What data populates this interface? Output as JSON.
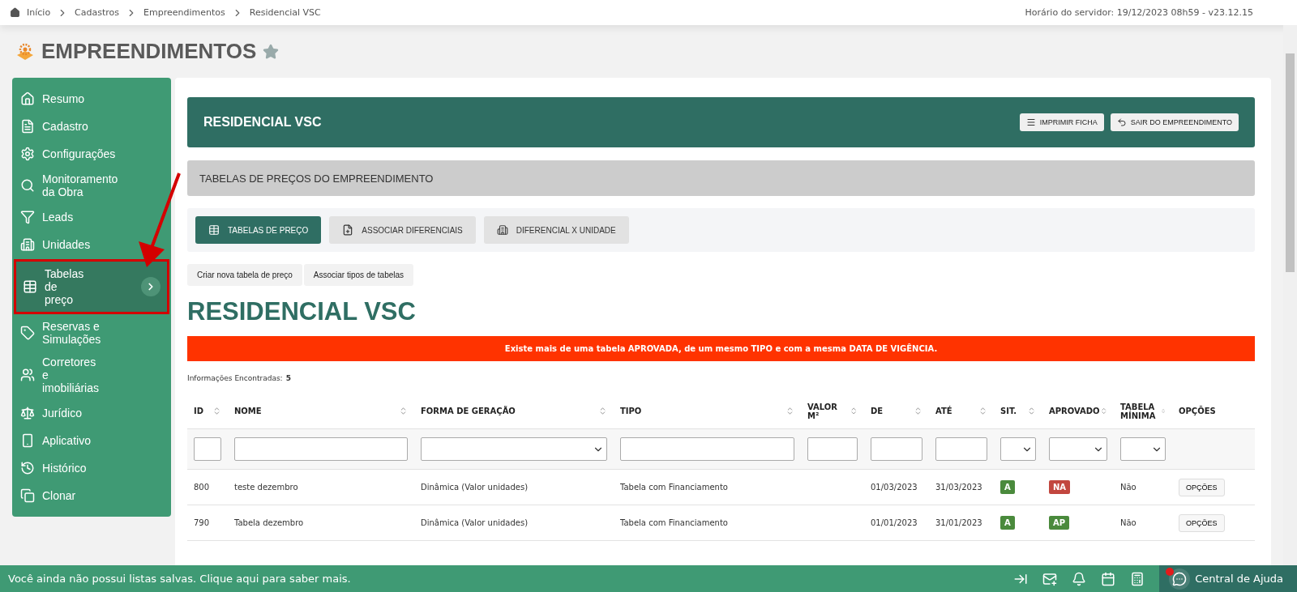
{
  "breadcrumbs": [
    "Início",
    "Cadastros",
    "Empreendimentos",
    "Residencial VSC"
  ],
  "server_info": "Horário do servidor: 19/12/2023 08h59 - v23.12.15",
  "page_title": "EMPREENDIMENTOS",
  "favorite": false,
  "sidebar": {
    "items": [
      {
        "label": "Resumo",
        "selected": false
      },
      {
        "label": "Cadastro",
        "selected": false
      },
      {
        "label": "Configurações",
        "selected": false
      },
      {
        "label": "Monitoramento da Obra",
        "selected": false
      },
      {
        "label": "Leads",
        "selected": false
      },
      {
        "label": "Unidades",
        "selected": false
      },
      {
        "label": "Tabelas de preço",
        "selected": true,
        "annotated": true
      },
      {
        "label": "Reservas e Simulações",
        "selected": false
      },
      {
        "label": "Corretores e imobiliárias",
        "selected": false
      },
      {
        "label": "Jurídico",
        "selected": false
      },
      {
        "label": "Aplicativo",
        "selected": false
      },
      {
        "label": "Histórico",
        "selected": false
      },
      {
        "label": "Clonar",
        "selected": false
      }
    ]
  },
  "header": {
    "title": "RESIDENCIAL VSC",
    "buttons": [
      "IMPRIMIR FICHA",
      "SAIR DO EMPREENDIMENTO"
    ]
  },
  "section_title": "TABELAS DE PREÇOS DO EMPREENDIMENTO",
  "tabs": [
    {
      "label": "TABELAS DE PREÇO",
      "selected": true
    },
    {
      "label": "ASSOCIAR DIFERENCIAIS",
      "selected": false
    },
    {
      "label": "DIFERENCIAL X UNIDADE",
      "selected": false
    }
  ],
  "actions": [
    "Criar nova tabela de preço",
    "Associar tipos de tabelas"
  ],
  "heading": "RESIDENCIAL VSC",
  "alert": "Existe mais de uma tabela APROVADA, de um mesmo TIPO e com a mesma DATA DE VIGÊNCIA.",
  "count_label": "Informações Encontradas:",
  "count": "5",
  "table": {
    "columns": [
      {
        "label": "ID",
        "sortable": true,
        "kind": "input"
      },
      {
        "label": "NOME",
        "sortable": true,
        "kind": "input"
      },
      {
        "label": "FORMA DE GERAÇÃO",
        "sortable": true,
        "kind": "select"
      },
      {
        "label": "TIPO",
        "sortable": true,
        "kind": "input"
      },
      {
        "label": "VALOR M²",
        "sortable": true,
        "kind": "input"
      },
      {
        "label": "DE",
        "sortable": true,
        "kind": "input"
      },
      {
        "label": "ATÉ",
        "sortable": true,
        "kind": "input"
      },
      {
        "label": "SIT.",
        "sortable": true,
        "kind": "select"
      },
      {
        "label": "APROVADO",
        "sortable": true,
        "kind": "select"
      },
      {
        "label": "TABELA MÍNIMA",
        "sortable": true,
        "kind": "select"
      },
      {
        "label": "OPÇÕES",
        "sortable": false,
        "kind": "none"
      }
    ],
    "rows": [
      {
        "id": "800",
        "nome": "teste dezembro",
        "forma": "Dinâmica (Valor unidades)",
        "tipo": "Tabela com Financiamento",
        "valor": "",
        "de": "01/03/2023",
        "ate": "31/03/2023",
        "sit": {
          "text": "A",
          "color": "#4a8a3c"
        },
        "aprovado": {
          "text": "NA",
          "color": "#c2473f"
        },
        "minima": "Não",
        "option": "OPÇÕES"
      },
      {
        "id": "790",
        "nome": "Tabela dezembro",
        "forma": "Dinâmica (Valor unidades)",
        "tipo": "Tabela com Financiamento",
        "valor": "",
        "de": "01/01/2023",
        "ate": "31/01/2023",
        "sit": {
          "text": "A",
          "color": "#4a8a3c"
        },
        "aprovado": {
          "text": "AP",
          "color": "#4a8a3c"
        },
        "minima": "Não",
        "option": "OPÇÕES"
      }
    ]
  },
  "bottom_bar": {
    "message": "Você ainda não possui listas salvas. Clique aqui para saber mais.",
    "help_label": "Central de Ajuda",
    "help_notification": true
  }
}
